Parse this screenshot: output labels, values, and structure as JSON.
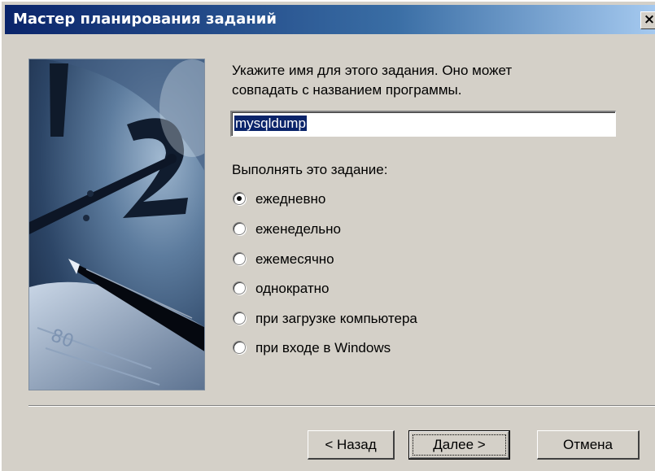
{
  "window": {
    "title": "Мастер планирования заданий",
    "close_glyph": "×"
  },
  "prompt": {
    "line1": "Укажите имя для этого задания. Оно может",
    "line2": "совпадать с названием программы."
  },
  "task_name": {
    "value": "mysqldump"
  },
  "schedule": {
    "label": "Выполнять это задание:",
    "options": [
      {
        "label": "ежедневно",
        "checked": true
      },
      {
        "label": "еженедельно",
        "checked": false
      },
      {
        "label": "ежемесячно",
        "checked": false
      },
      {
        "label": "однократно",
        "checked": false
      },
      {
        "label": "при загрузке компьютера",
        "checked": false
      },
      {
        "label": "при входе в Windows",
        "checked": false
      }
    ]
  },
  "buttons": {
    "back": "< Назад",
    "next": "Далее >",
    "cancel": "Отмена"
  },
  "colors": {
    "titlebar_start": "#0a246a",
    "titlebar_end": "#a6caf0",
    "face": "#d4d0c8",
    "selection": "#0a246a"
  }
}
